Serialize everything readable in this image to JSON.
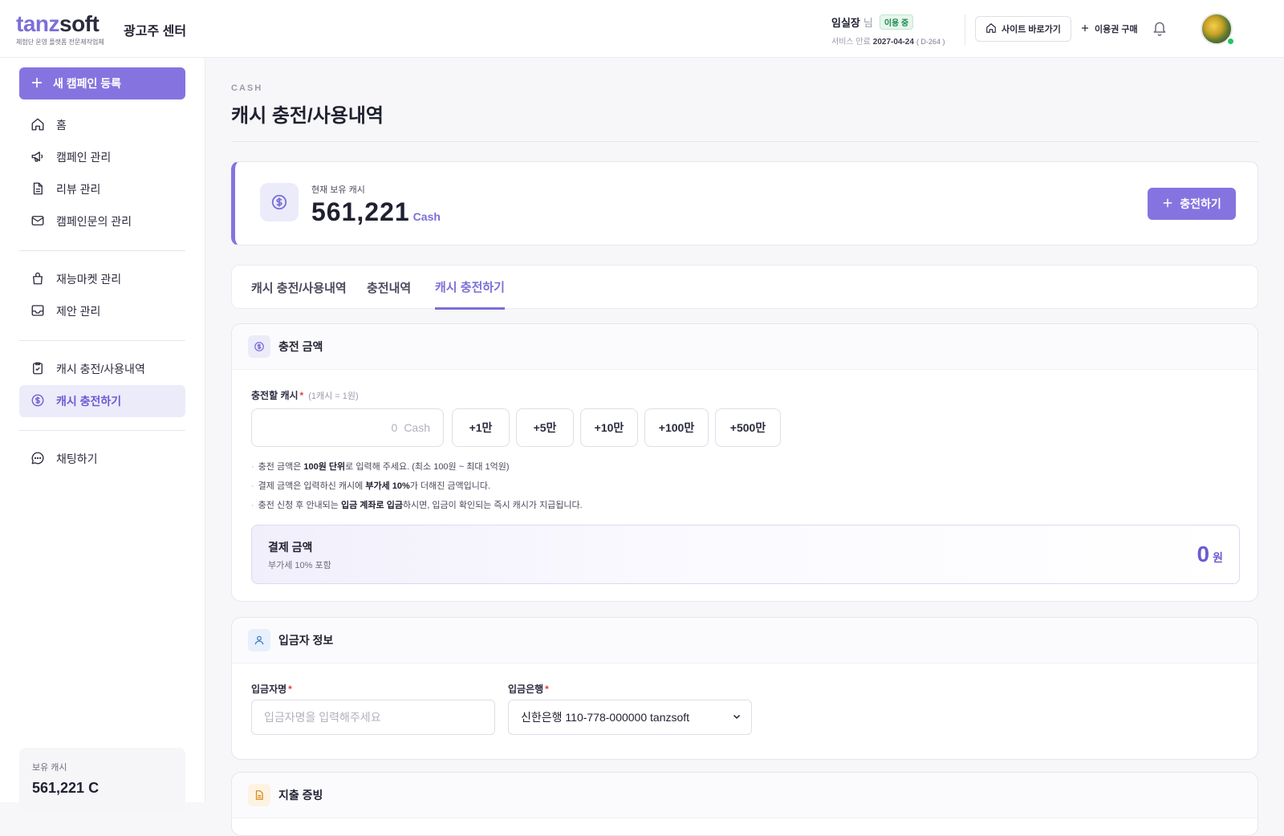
{
  "header": {
    "logo_part1": "tanz",
    "logo_part2": "soft",
    "logo_tagline": "체험단 운영 플랫폼 전문제작업체",
    "center_title": "광고주 센터",
    "user_name": "임실장",
    "user_suffix": "님",
    "status_badge": "이용 중",
    "expire_label": "서비스 만료",
    "expire_date": "2027-04-24",
    "expire_dday": "( D-264 )",
    "site_button": "사이트 바로가기",
    "buy_button": "이용권 구매"
  },
  "sidebar": {
    "new_campaign": "새 캠페인 등록",
    "items": [
      {
        "label": "홈"
      },
      {
        "label": "캠페인 관리"
      },
      {
        "label": "리뷰 관리"
      },
      {
        "label": "캠페인문의 관리"
      },
      {
        "label": "재능마켓 관리"
      },
      {
        "label": "제안 관리"
      },
      {
        "label": "캐시 충전/사용내역"
      },
      {
        "label": "캐시 충전하기"
      },
      {
        "label": "채팅하기"
      }
    ],
    "cash_label": "보유 캐시",
    "cash_value": "561,221 C"
  },
  "page": {
    "eyebrow": "CASH",
    "title": "캐시 충전/사용내역"
  },
  "balance": {
    "label": "현재 보유 캐시",
    "value": "561,221",
    "unit": "Cash",
    "charge_button": "충전하기"
  },
  "tabs": [
    {
      "label": "캐시 충전/사용내역"
    },
    {
      "label": "충전내역"
    },
    {
      "label": "캐시 충전하기"
    }
  ],
  "charge": {
    "section_title": "충전 금액",
    "field_label": "충전할 캐시",
    "field_hint": "(1캐시 = 1원)",
    "input_value": "0",
    "input_unit": "Cash",
    "quick_buttons": [
      "+1만",
      "+5만",
      "+10만",
      "+100만",
      "+500만"
    ],
    "notes": [
      {
        "pre": "충전 금액은 ",
        "bold": "100원 단위",
        "post": "로 입력해 주세요. (최소 100원 ~ 최대 1억원)"
      },
      {
        "pre": "결제 금액은 입력하신 캐시에 ",
        "bold": "부가세 10%",
        "post": "가 더해진 금액입니다."
      },
      {
        "pre": "충전 신청 후 안내되는 ",
        "bold": "입금 계좌로 입금",
        "post": "하시면, 입금이 확인되는 즉시 캐시가 지급됩니다."
      }
    ],
    "pay_title": "결제 금액",
    "pay_sub": "부가세 10% 포함",
    "pay_amount": "0",
    "pay_unit": "원"
  },
  "depositor": {
    "section_title": "입금자 정보",
    "name_label": "입금자명",
    "name_placeholder": "입금자명을 입력해주세요",
    "bank_label": "입금은행",
    "bank_value": "신한은행 110-778-000000 tanzsoft"
  },
  "receipt": {
    "section_title": "지출 증빙"
  },
  "colors": {
    "accent": "#8574e0",
    "accent_text": "#7b6fd8",
    "online": "#22c55e",
    "required": "#e23d3d"
  }
}
